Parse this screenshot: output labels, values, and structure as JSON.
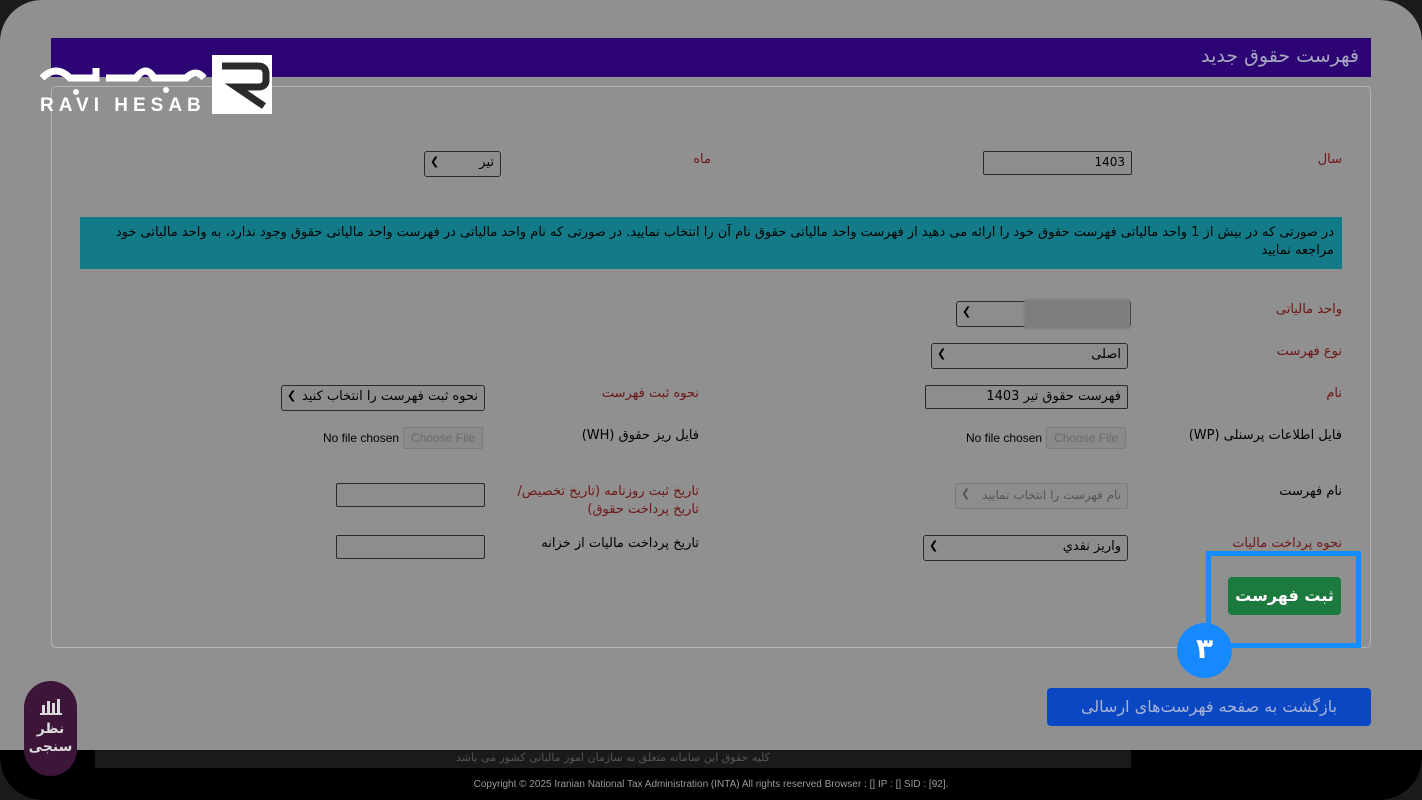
{
  "logo": {
    "brand_fa": "راوی حساب",
    "brand_en": "RAVI HESAB"
  },
  "header": {
    "title": "فهرست حقوق جدید"
  },
  "form": {
    "year_label": "سال",
    "year_value": "1403",
    "month_label": "ماه",
    "month_value": "تیر",
    "info_text": "در صورتی که در بیش از 1 واحد مالیاتی فهرست حقوق خود را ارائه می دهید از فهرست واحد مالیاتی حقوق نام آن را انتخاب نمایید. در صورتی که نام واحد مالیاتی در فهرست واحد مالیاتی حقوق وجود ندارد، به واحد مالیاتی خود مراجعه نمایید",
    "tax_unit_label": "واحد مالیاتی",
    "list_type_label": "نوع فهرست",
    "list_type_value": "اصلی",
    "name_label": "نام",
    "name_value": "فهرست حقوق تیر 1403",
    "register_method_label": "نحوه ثبت فهرست",
    "register_method_value": "نحوه ثبت فهرست را انتخاب کنید",
    "personnel_file_label": "فایل اطلاعات پرسنلی (WP)",
    "salary_file_label": "فایل ریز حقوق (WH)",
    "choose_file_label": "Choose File",
    "no_file_label": "No file chosen",
    "list_name_label": "نام فهرست",
    "list_name_value": "نام فهرست را انتخاب نمایید",
    "journal_date_label_1": "تاریخ ثبت روزنامه (تاریخ تخصیص/",
    "journal_date_label_2": "تاریخ پرداخت حقوق)",
    "tax_payment_method_label": "نحوه پرداخت مالیات",
    "tax_payment_method_value": "واریز نقدي",
    "treasury_date_label": "تاریخ پرداخت مالیات از خزانه",
    "submit_label": "ثبت فهرست"
  },
  "step_badge": "۳",
  "back_button": "بازگشت به صفحه فهرست‌های ارسالی",
  "footer": {
    "notice": "کلیه حقوق این سامانه متعلق به سازمان امور مالیاتی کشور می باشد",
    "copyright": "Copyright © 2025 Iranian National Tax Administration (INTA) All rights reserved Browser : [] IP : [] SID : [92]."
  },
  "survey": {
    "line1": "نظر",
    "line2": "سنجی"
  }
}
